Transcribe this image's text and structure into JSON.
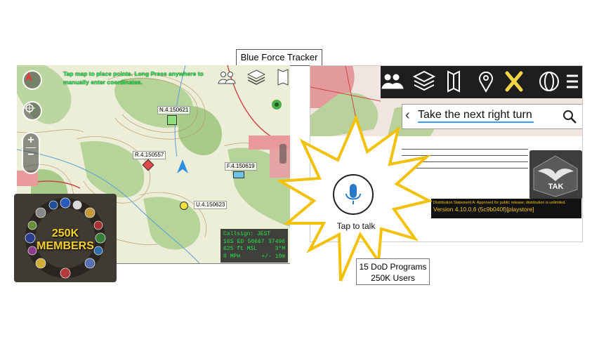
{
  "title": "Blue Force Tracker",
  "left_map": {
    "hint": "Tap map to place points. Long Press anywhere to manually enter coordinates.",
    "markers": [
      {
        "label": "N.4.150621",
        "color": "#8fe07a"
      },
      {
        "label": "R.4.150557",
        "color": "#e04a4a"
      },
      {
        "label": "F.4.150619",
        "color": "#6fc3e8"
      },
      {
        "label": "U.4.150623",
        "color": "#f0e040"
      }
    ],
    "status": {
      "callsign": "Callsign: JEST",
      "grid": "16S",
      "easting_zone": "ED",
      "easting": "50667",
      "northing": "37496",
      "altitude": "625 ft MSL",
      "heading": "3°M",
      "speed": "0 MPH",
      "accuracy": "+/- 10m"
    }
  },
  "members_badge": {
    "line1": "250K",
    "line2": "MEMBERS"
  },
  "right_app": {
    "search_value": "Take the next right turn",
    "distribution": "Distribution Statement A: Approved for public release; distribution is unlimited.",
    "version": "Version 4.10.0.6 (5c9b040f)[playstore]",
    "logo_text": "TAK"
  },
  "voice": {
    "label": "Tap to talk"
  },
  "programs": {
    "line1": "15 DoD Programs",
    "line2": "250K Users"
  },
  "colors": {
    "accent_green": "#22e04a",
    "speech_burst": "#f2c10c",
    "tak_yellow": "#f4c40f"
  }
}
